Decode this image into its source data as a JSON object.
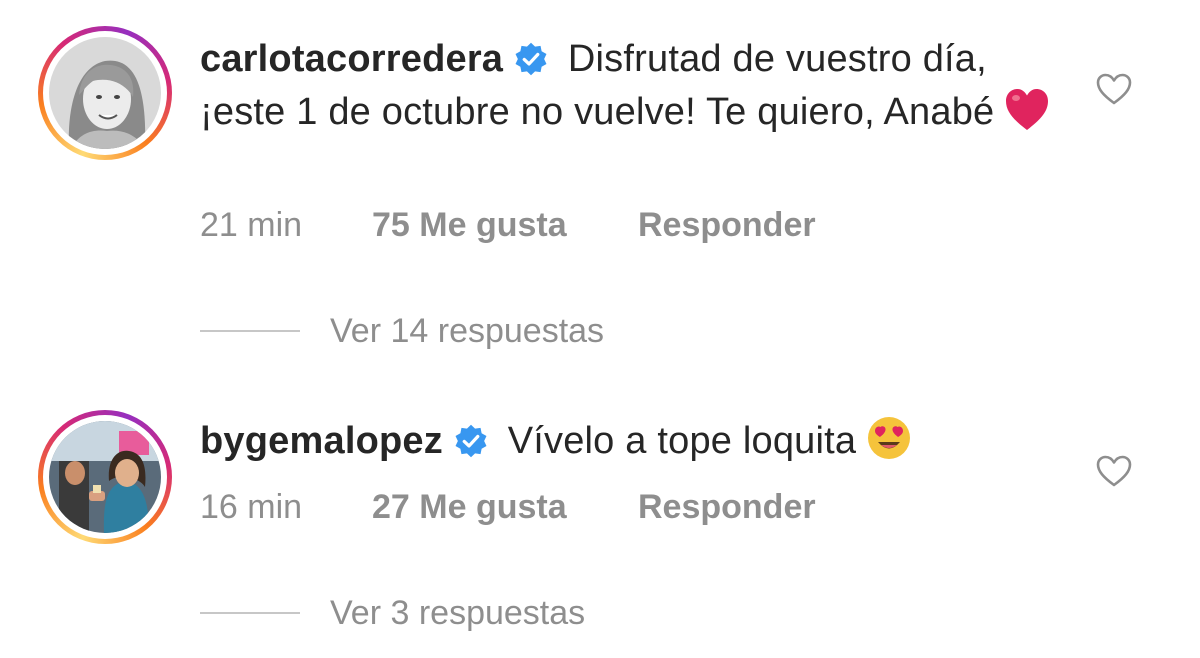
{
  "comments": [
    {
      "username": "carlotacorredera",
      "verified": true,
      "text": "Disfrutad de vuestro día, ¡este 1 de octubre no vuelve! Te quiero, Anabé",
      "emoji": "red-heart",
      "time": "21 min",
      "likes": "75 Me gusta",
      "reply_label": "Responder",
      "view_replies": "Ver 14 respuestas"
    },
    {
      "username": "bygemalopez",
      "verified": true,
      "text": "Vívelo a tope loquita",
      "emoji": "heart-eyes",
      "time": "16 min",
      "likes": "27 Me gusta",
      "reply_label": "Responder",
      "view_replies": "Ver 3 respuestas"
    }
  ],
  "colors": {
    "text": "#262626",
    "secondary": "#8e8e8e",
    "verified": "#3897f0",
    "emoji_heart": "#e0245e",
    "emoji_face": "#f5c33b"
  }
}
